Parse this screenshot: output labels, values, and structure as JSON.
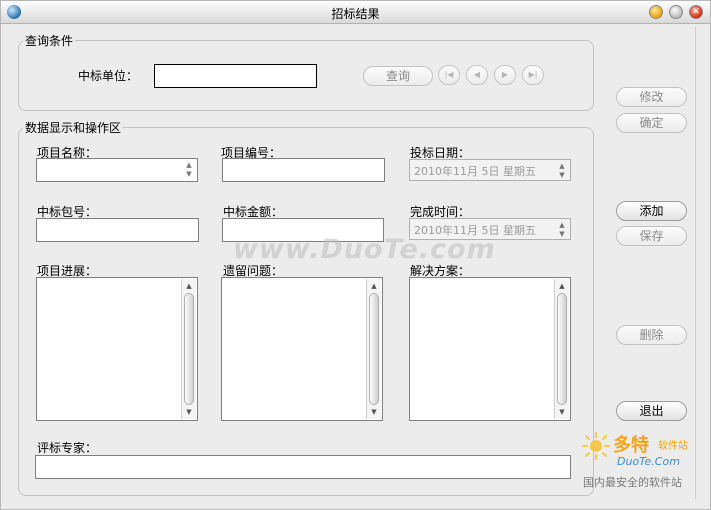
{
  "window": {
    "title": "招标结果"
  },
  "query_group": {
    "legend": "查询条件",
    "winning_unit_label": "中标单位：",
    "winning_unit_value": "",
    "query_button": "查询"
  },
  "data_group": {
    "legend": "数据显示和操作区",
    "project_name_label": "项目名称：",
    "project_name_value": "",
    "project_no_label": "项目编号：",
    "project_no_value": "",
    "bid_date_label": "投标日期：",
    "bid_date_value": "2010年11月  5日 星期五",
    "package_no_label": "中标包号：",
    "package_no_value": "",
    "amount_label": "中标金额：",
    "amount_value": "",
    "finish_time_label": "完成时间：",
    "finish_time_value": "2010年11月  5日 星期五",
    "progress_label": "项目进展：",
    "issues_label": "遗留问题：",
    "solution_label": "解决方案：",
    "experts_label": "评标专家：",
    "experts_value": ""
  },
  "sidebar": {
    "modify": "修改",
    "confirm": "确定",
    "add": "添加",
    "save": "保存",
    "delete": "删除",
    "exit": "退出"
  },
  "watermark": {
    "text": "www.DuoTe.com"
  },
  "logo": {
    "name": "多特",
    "subtitle": "软件站",
    "url": "DuoTe.Com",
    "slogan": "国内最安全的软件站"
  },
  "colors": {
    "logo_orange": "#f5a31a",
    "logo_blue": "#3a8fd6",
    "window_bg": "#ececec"
  }
}
